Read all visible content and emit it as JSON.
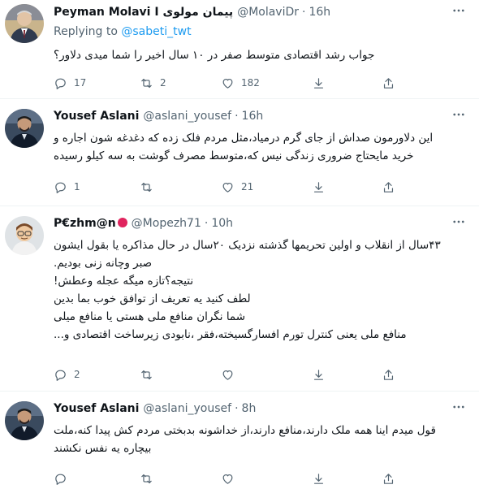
{
  "tweets": [
    {
      "name": "Peyman Molavi I پیمان مولوی",
      "handle": "@MolaviDr",
      "time": "16h",
      "replying_label": "Replying to",
      "replying_handle": "@sabeti_twt",
      "lines": [
        "جواب رشد اقتصادی متوسط صفر در ۱۰ سال اخیر را شما میدی دلاور؟"
      ],
      "stats": {
        "replies": "17",
        "retweets": "2",
        "likes": "182"
      },
      "avatar_icon": "avatar-man-suit-icon"
    },
    {
      "name": "Yousef Aslani",
      "handle": "@aslani_yousef",
      "time": "16h",
      "lines": [
        "این دلاورمون صداش از جای گرم درمیاد،مثل مردم فلک زده که دغدغه شون اجاره و",
        "خرید مایحتاج ضروری زندگی نیس که،متوسط مصرف گوشت به سه کیلو رسیده"
      ],
      "stats": {
        "replies": "1",
        "retweets": "",
        "likes": "21"
      },
      "avatar_icon": "avatar-man-dark-icon"
    },
    {
      "name": "P€zhm@n",
      "handle": "@Mopezh71",
      "time": "10h",
      "lines": [
        "۴۳سال از انقلاب و اولین تحریمها گذشته نزدیک ۲۰سال در حال مذاکره یا بقول ایشون",
        "صبر وچانه زنی بودیم.",
        "نتیجه؟تازه میگه عجله وعطش!",
        "لطف کنید یه تعریف از توافق خوب بما بدین",
        "شما نگران منافع ملی هستی یا منافع میلی",
        "منافع ملی یعنی کنترل تورم افسارگسیخته،فقر ،نابودی زیرساخت اقتصادی و..."
      ],
      "stats": {
        "replies": "2",
        "retweets": "",
        "likes": ""
      },
      "avatar_icon": "avatar-memoji-icon",
      "badge_color": "#e0245e"
    },
    {
      "name": "Yousef Aslani",
      "handle": "@aslani_yousef",
      "time": "8h",
      "lines": [
        "قول میدم اینا همه ملک دارند،منافع دارند،از خداشونه بدبختی مردم کش پیدا کنه،ملت",
        "بیچاره یه نفس نکشند"
      ],
      "stats": {
        "replies": "",
        "retweets": "",
        "likes": ""
      },
      "avatar_icon": "avatar-man-dark-icon"
    }
  ],
  "icons": {
    "reply": "reply-icon",
    "retweet": "retweet-icon",
    "like": "like-icon",
    "download": "download-icon",
    "share": "share-icon",
    "more": "more-icon"
  },
  "colors": {
    "link": "#1d9bf0",
    "secondary_text": "#536471",
    "divider": "#eff3f4"
  }
}
